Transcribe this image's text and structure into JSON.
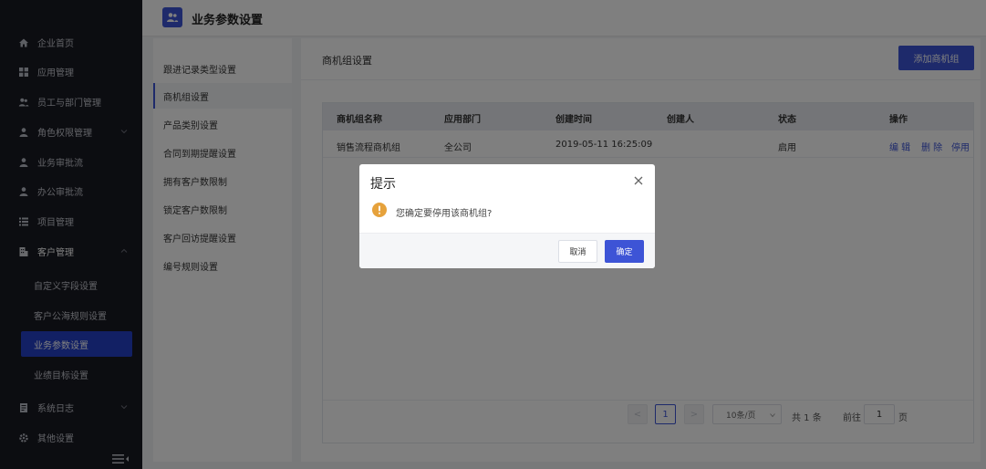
{
  "colors": {
    "sidebar_bg": "#191a23",
    "accent": "#3d54d6",
    "active_sub": "#2540c9"
  },
  "sidebar": {
    "items": [
      {
        "label": "企业首页",
        "icon": "home-icon"
      },
      {
        "label": "应用管理",
        "icon": "grid-icon"
      },
      {
        "label": "员工与部门管理",
        "icon": "users-icon"
      },
      {
        "label": "角色权限管理",
        "icon": "user-icon"
      },
      {
        "label": "业务审批流",
        "icon": "user-icon"
      },
      {
        "label": "办公审批流",
        "icon": "user-icon"
      },
      {
        "label": "项目管理",
        "icon": "list-icon"
      },
      {
        "label": "客户管理",
        "icon": "building-icon"
      }
    ],
    "sub_items": [
      {
        "label": "自定义字段设置"
      },
      {
        "label": "客户公海规则设置"
      },
      {
        "label": "业务参数设置"
      },
      {
        "label": "业绩目标设置"
      }
    ],
    "bottom_items": [
      {
        "label": "系统日志",
        "icon": "log-icon"
      },
      {
        "label": "其他设置",
        "icon": "gear-icon"
      }
    ]
  },
  "header": {
    "title": "业务参数设置"
  },
  "settings_menu": {
    "items": [
      "跟进记录类型设置",
      "商机组设置",
      "产品类别设置",
      "合同到期提醒设置",
      "拥有客户数限制",
      "锁定客户数限制",
      "客户回访提醒设置",
      "编号规则设置"
    ]
  },
  "main": {
    "section_title": "商机组设置",
    "add_button": "添加商机组",
    "table": {
      "columns": [
        "商机组名称",
        "应用部门",
        "创建时间",
        "创建人",
        "状态",
        "操作"
      ],
      "rows": [
        {
          "name": "销售流程商机组",
          "dept": "全公司",
          "created": "2019-05-11 16:25:09",
          "creator": "",
          "status": "启用",
          "ops": [
            "编 辑",
            "删 除",
            "停用"
          ]
        }
      ]
    },
    "pagination": {
      "prev": "<",
      "next": ">",
      "current_page": "1",
      "page_size": "10条/页",
      "total": "共 1 条",
      "goto_label": "前往",
      "goto_value": "1",
      "page_suffix": "页"
    }
  },
  "dialog": {
    "title": "提示",
    "message": "您确定要停用该商机组?",
    "cancel": "取消",
    "ok": "确定"
  }
}
